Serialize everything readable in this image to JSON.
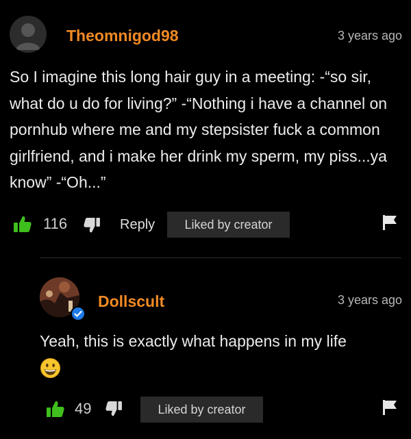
{
  "comments": [
    {
      "username": "Theomnigod98",
      "timestamp": "3 years ago",
      "text": "So I imagine this long hair guy in a meeting: -“so sir, what do u do for living?” -“Nothing i have a channel on pornhub where me and my stepsister fuck a common girlfriend, and i make her drink my sperm, my piss...ya know” -“Oh...”",
      "likes": "116",
      "reply_label": "Reply",
      "liked_badge": "Liked by creator"
    }
  ],
  "reply": {
    "username": "Dollscult",
    "timestamp": "3 years ago",
    "text": "Yeah, this is exactly what happens in my life",
    "likes": "49",
    "liked_badge": "Liked by creator",
    "verified": true
  },
  "colors": {
    "background": "#000000",
    "username": "#f08a24",
    "like_icon": "#3fbf1e",
    "text": "#ececec",
    "muted": "#b7b7b7",
    "badge_bg": "#2a2a2a",
    "verified": "#1f7be8"
  },
  "icons": [
    "default-avatar-icon",
    "thumbs-up-icon",
    "thumbs-down-icon",
    "flag-icon",
    "verified-check-icon",
    "grinning-emoji-icon"
  ]
}
